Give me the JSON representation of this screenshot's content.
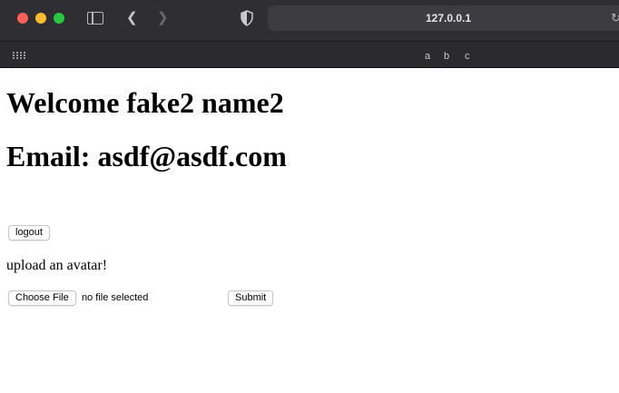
{
  "browser": {
    "address": "127.0.0.1",
    "bookmarks": [
      "a",
      "b",
      "c"
    ]
  },
  "page": {
    "welcome": "Welcome fake2 name2",
    "email": "Email: asdf@asdf.com",
    "logout_label": "logout",
    "upload_label": "upload an avatar!",
    "choose_file_label": "Choose File",
    "file_status": "no file selected",
    "submit_label": "Submit"
  },
  "colors": {
    "chrome_bg": "#2b2a2e",
    "close": "#ff5f57",
    "minimize": "#febc2e",
    "maximize": "#28c840"
  }
}
